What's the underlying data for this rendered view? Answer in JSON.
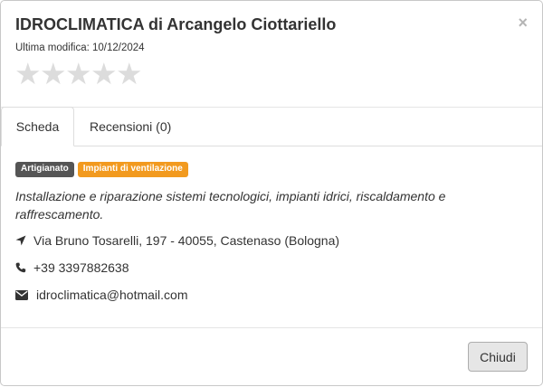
{
  "modal": {
    "title": "IDROCLIMATICA di Arcangelo Ciottariello",
    "close_symbol": "×",
    "last_modified": "Ultima modifica: 10/12/2024",
    "rating": {
      "value": 0,
      "max": 5,
      "star_symbol": "★",
      "empty_color": "#dcdcdc"
    }
  },
  "tabs": [
    {
      "label": "Scheda",
      "active": true
    },
    {
      "label": "Recensioni (0)",
      "active": false
    }
  ],
  "content": {
    "badges": [
      {
        "label": "Artigianato",
        "color": "#555555"
      },
      {
        "label": "Impianti di ventilazione",
        "color": "#f29a1f"
      }
    ],
    "description": "Installazione e riparazione sistemi tecnologici, impianti idrici, riscaldamento e raffrescamento.",
    "address": {
      "icon": "location-arrow-icon",
      "text": "Via Bruno Tosarelli, 197 - 40055, Castenaso (Bologna)"
    },
    "phone": {
      "icon": "phone-icon",
      "text": "+39 3397882638"
    },
    "email": {
      "icon": "envelope-icon",
      "text": "idroclimatica@hotmail.com"
    }
  },
  "footer": {
    "close_label": "Chiudi"
  }
}
